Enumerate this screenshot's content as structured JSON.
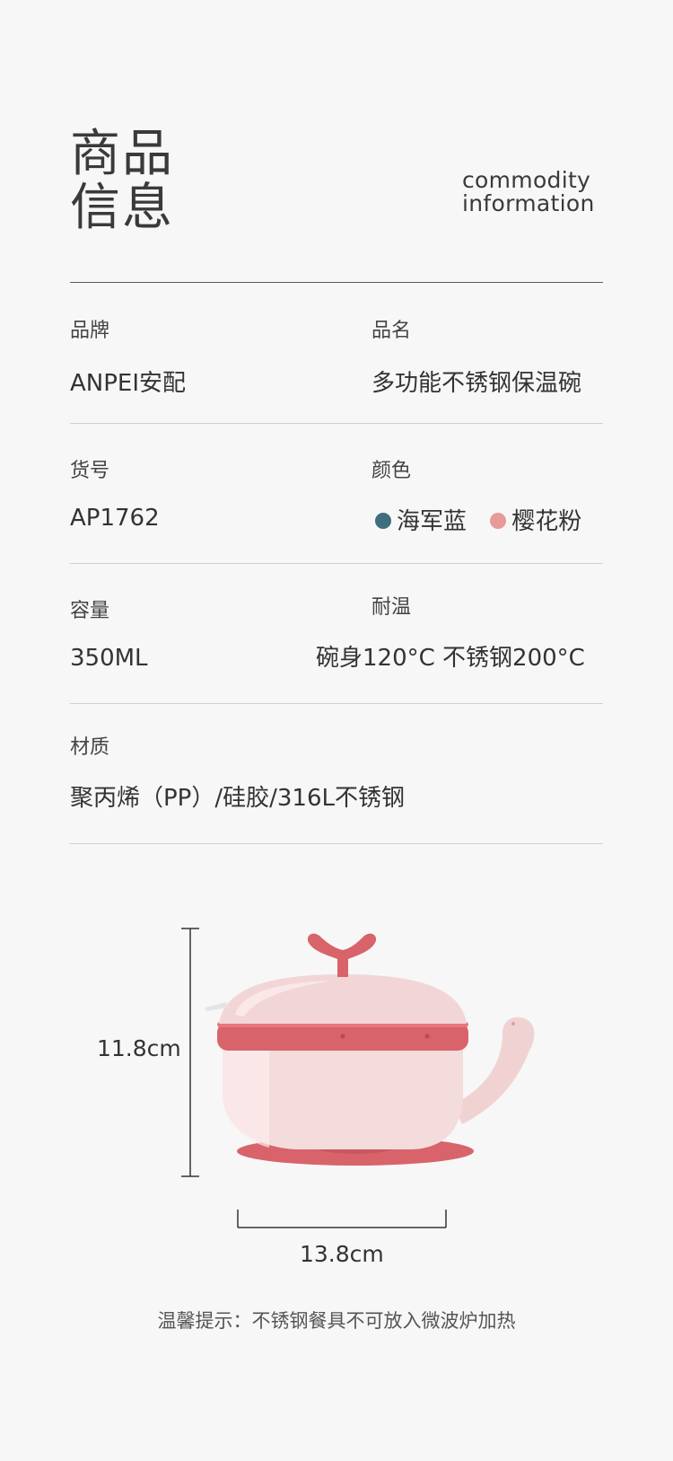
{
  "header": {
    "title_cn_line1": "商品",
    "title_cn_line2": "信息",
    "title_en_line1": "commodity",
    "title_en_line2": "information"
  },
  "specs": {
    "brand_label": "品牌",
    "brand_value": "ANPEI安配",
    "name_label": "品名",
    "name_value": "多功能不锈钢保温碗",
    "sku_label": "货号",
    "sku_value": "AP1762",
    "color_label": "颜色",
    "colors": [
      {
        "name": "海军蓝",
        "hex": "#3f6e7f"
      },
      {
        "name": "樱花粉",
        "hex": "#e89a98"
      }
    ],
    "capacity_label": "容量",
    "capacity_value": "350ML",
    "heat_label": "耐温",
    "heat_value": "碗身120°C  不锈钢200°C",
    "material_label": "材质",
    "material_value": "聚丙烯（PP）/硅胶/316L不锈钢"
  },
  "figure": {
    "height_label": "11.8cm",
    "width_label": "13.8cm",
    "accent_color": "#d9636a",
    "body_color": "#f5d9da"
  },
  "tip": "温馨提示：不锈钢餐具不可放入微波炉加热"
}
